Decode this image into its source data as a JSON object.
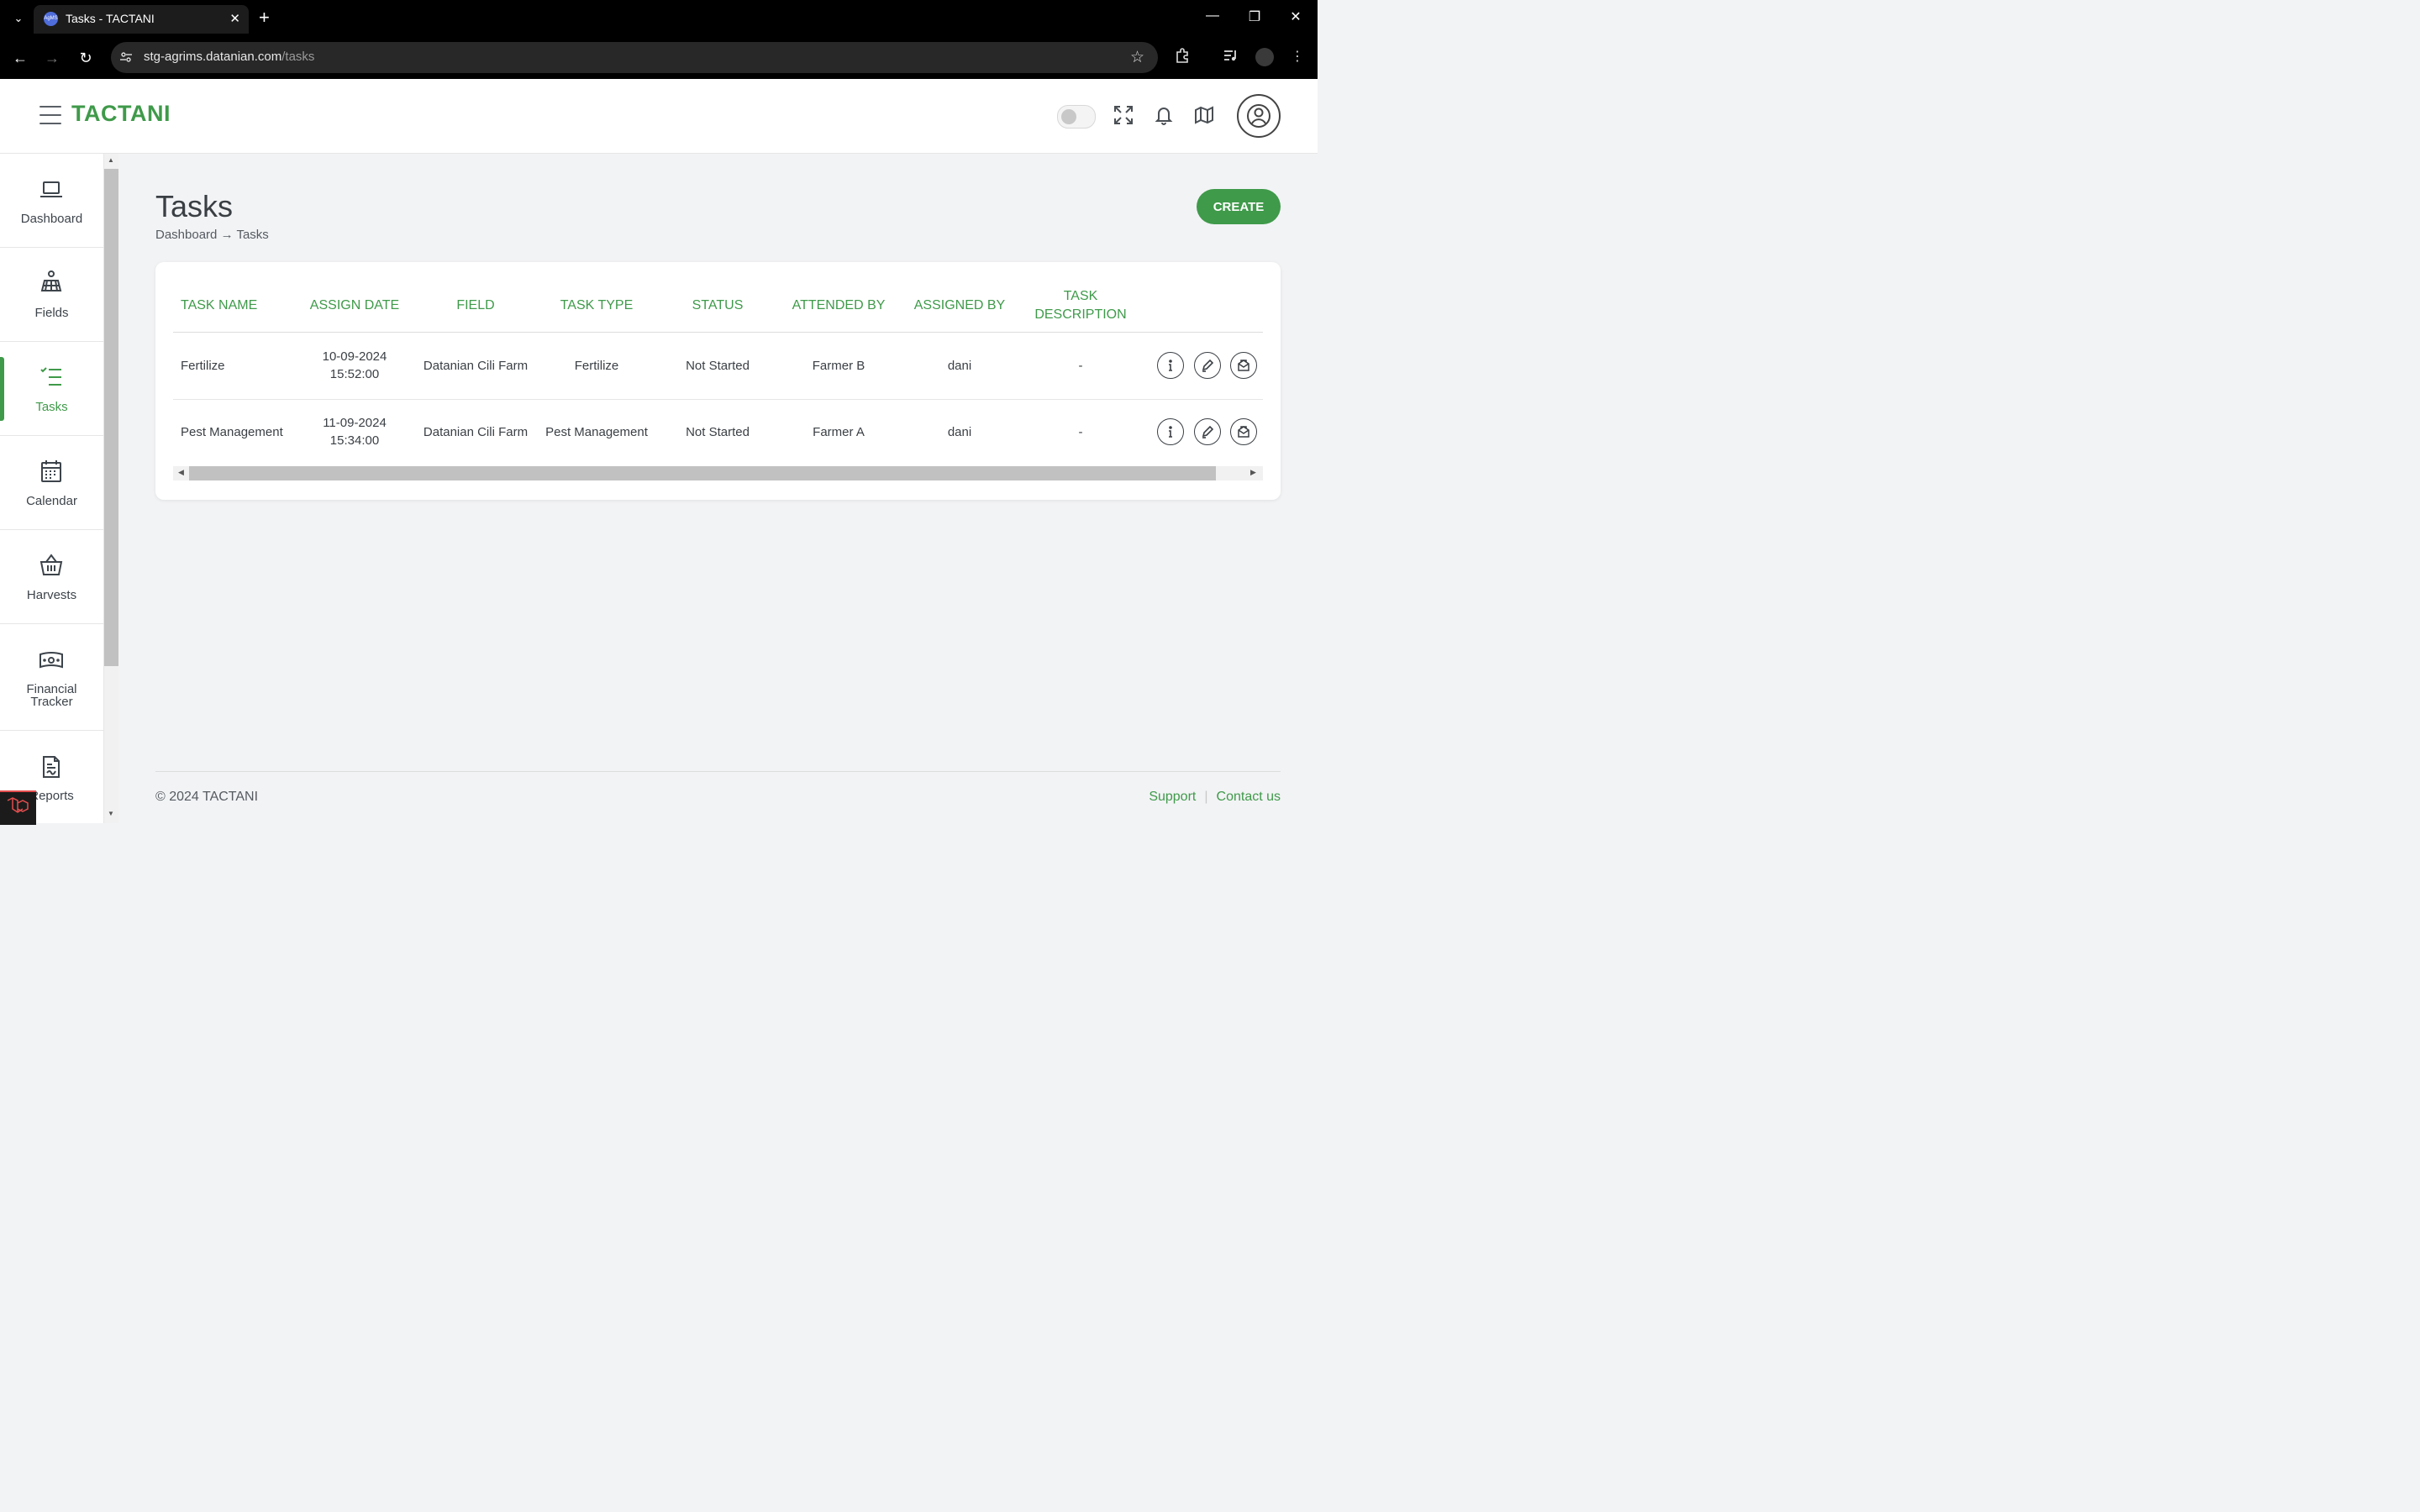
{
  "browser": {
    "tab_title": "Tasks - TACTANI",
    "favicon_text": "AgMS",
    "url_host": "stg-agrims.datanian.com",
    "url_path": "/tasks"
  },
  "header": {
    "brand": "TACTANI"
  },
  "sidebar": {
    "items": [
      {
        "label": "Dashboard",
        "icon": "laptop-icon"
      },
      {
        "label": "Fields",
        "icon": "field-icon"
      },
      {
        "label": "Tasks",
        "icon": "task-list-icon"
      },
      {
        "label": "Calendar",
        "icon": "calendar-icon"
      },
      {
        "label": "Harvests",
        "icon": "basket-icon"
      },
      {
        "label": "Financial",
        "label2": "Tracker",
        "icon": "money-icon"
      },
      {
        "label": "Reports",
        "icon": "report-icon"
      }
    ],
    "active": "Tasks"
  },
  "page": {
    "title": "Tasks",
    "breadcrumb": {
      "root": "Dashboard",
      "separator": "→",
      "current": "Tasks"
    },
    "create_label": "CREATE"
  },
  "table": {
    "headers": [
      "TASK NAME",
      "ASSIGN DATE",
      "FIELD",
      "TASK TYPE",
      "STATUS",
      "ATTENDED BY",
      "ASSIGNED BY",
      "TASK",
      "DESCRIPTION"
    ],
    "rows": [
      {
        "task_name": "Fertilize",
        "date": "10-09-2024",
        "time": "15:52:00",
        "field": "Datanian Cili Farm",
        "task_type": "Fertilize",
        "status": "Not Started",
        "attended_by": "Farmer B",
        "assigned_by": "dani",
        "description": "-"
      },
      {
        "task_name": "Pest Management",
        "date": "11-09-2024",
        "time": "15:34:00",
        "field": "Datanian Cili Farm",
        "task_type": "Pest Management",
        "status": "Not Started",
        "attended_by": "Farmer A",
        "assigned_by": "dani",
        "description": "-"
      }
    ]
  },
  "footer": {
    "copyright": "© 2024 TACTANI",
    "support": "Support",
    "separator": "|",
    "contact": "Contact us"
  },
  "colors": {
    "brand_green": "#3f9a4a",
    "text": "#3a3f44",
    "background": "#f2f3f5"
  }
}
